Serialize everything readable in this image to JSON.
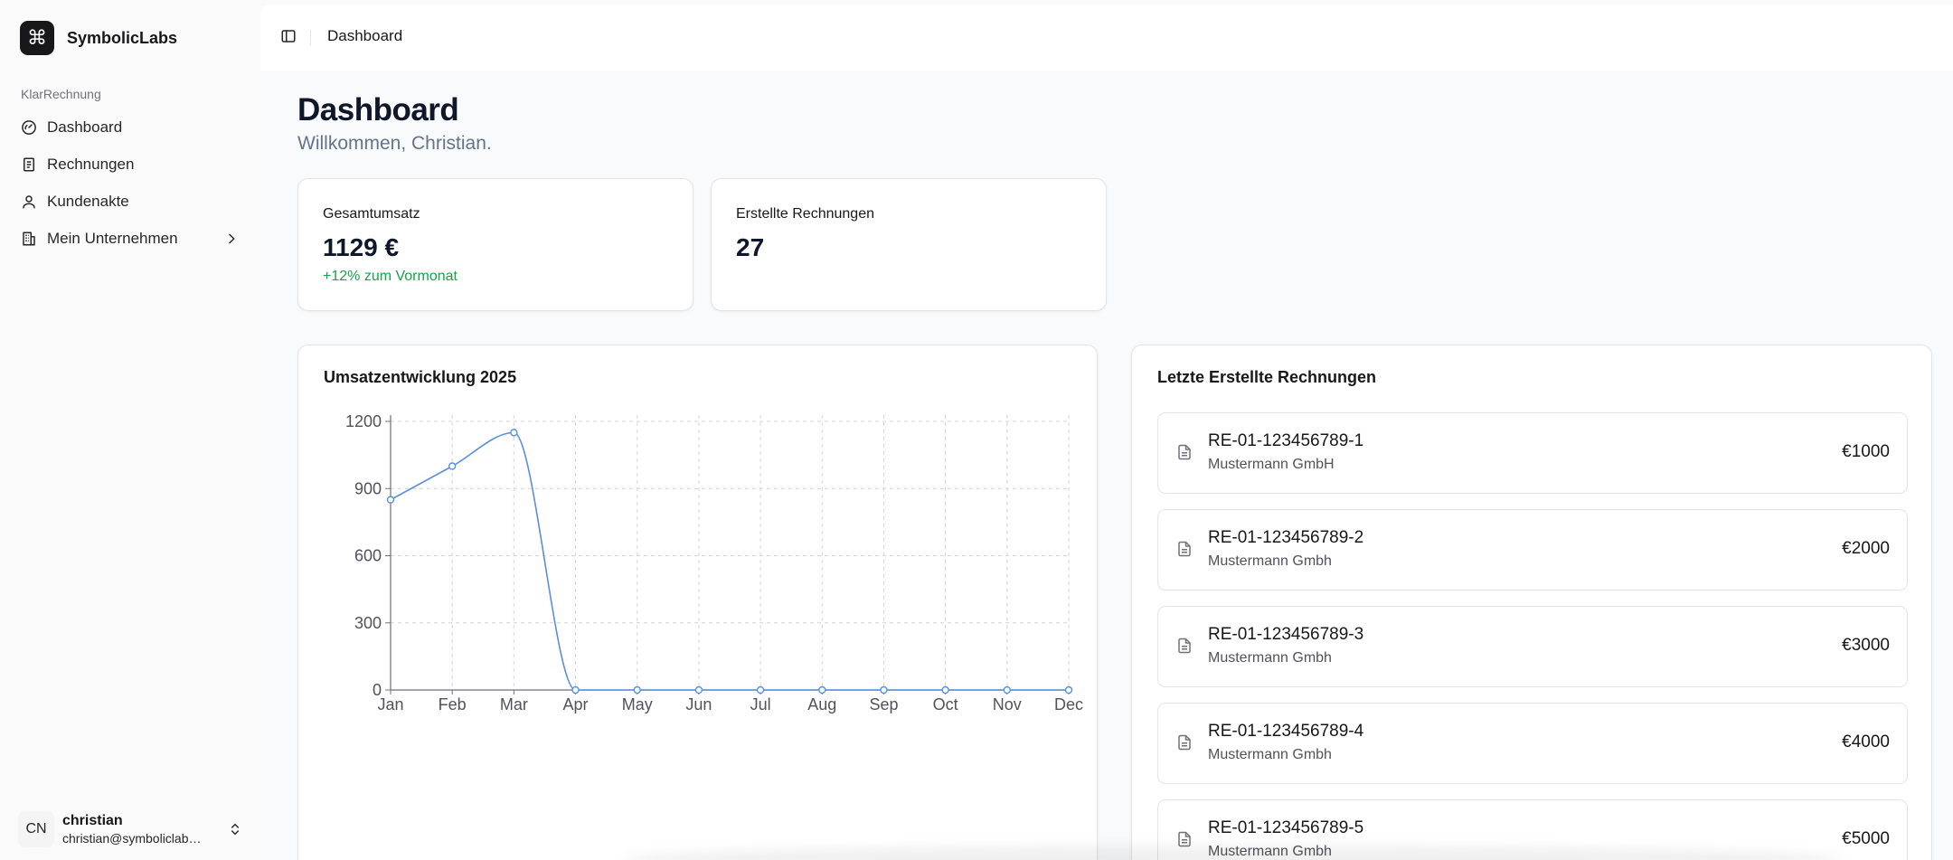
{
  "brand": {
    "logo_glyph": "⌘",
    "name": "SymbolicLabs"
  },
  "sidebar": {
    "section_label": "KlarRechnung",
    "items": [
      {
        "label": "Dashboard",
        "icon": "gauge-icon"
      },
      {
        "label": "Rechnungen",
        "icon": "receipt-icon"
      },
      {
        "label": "Kundenakte",
        "icon": "user-icon"
      },
      {
        "label": "Mein Unternehmen",
        "icon": "building-icon",
        "has_submenu": true
      }
    ]
  },
  "user": {
    "initials": "CN",
    "name": "christian",
    "email": "christian@symboliclabs.com"
  },
  "topbar": {
    "breadcrumb": "Dashboard"
  },
  "page": {
    "title": "Dashboard",
    "subtitle": "Willkommen, Christian."
  },
  "stats": [
    {
      "label": "Gesamtumsatz",
      "value": "1129 €",
      "trend": "+12% zum Vormonat"
    },
    {
      "label": "Erstellte Rechnungen",
      "value": "27",
      "trend": ""
    }
  ],
  "chart_title": "Umsatzentwicklung 2025",
  "chart_data": {
    "type": "line",
    "categories": [
      "Jan",
      "Feb",
      "Mar",
      "Apr",
      "May",
      "Jun",
      "Jul",
      "Aug",
      "Sep",
      "Oct",
      "Nov",
      "Dec"
    ],
    "values": [
      850,
      1000,
      1150,
      0,
      0,
      0,
      0,
      0,
      0,
      0,
      0,
      0
    ],
    "ylim": [
      0,
      1200
    ],
    "yticks": [
      "0",
      "300",
      "600",
      "900",
      "1200"
    ],
    "grid": true,
    "title": "",
    "xlabel": "",
    "ylabel": "",
    "color": "#5b8fd9"
  },
  "invoices_title": "Letzte Erstellte Rechnungen",
  "invoices": [
    {
      "number": "RE-01-123456789-1",
      "customer": "Mustermann GmbH",
      "amount": "€1000"
    },
    {
      "number": "RE-01-123456789-2",
      "customer": "Mustermann Gmbh",
      "amount": "€2000"
    },
    {
      "number": "RE-01-123456789-3",
      "customer": "Mustermann Gmbh",
      "amount": "€3000"
    },
    {
      "number": "RE-01-123456789-4",
      "customer": "Mustermann Gmbh",
      "amount": "€4000"
    },
    {
      "number": "RE-01-123456789-5",
      "customer": "Mustermann Gmbh",
      "amount": "€5000"
    }
  ]
}
